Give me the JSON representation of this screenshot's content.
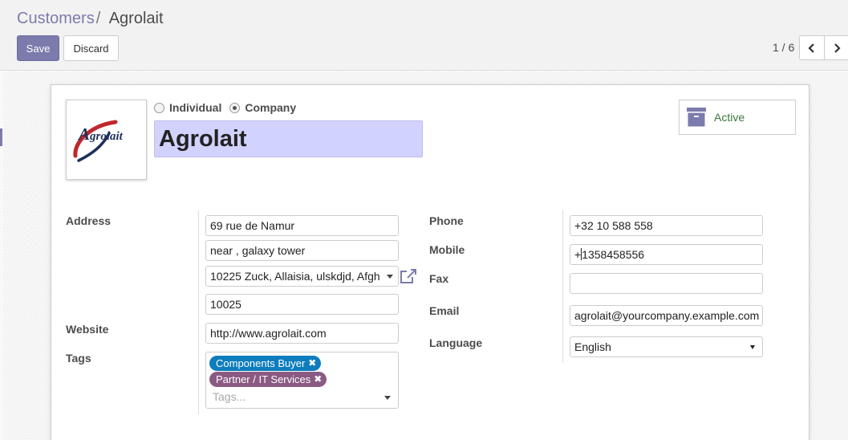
{
  "breadcrumb": {
    "parent": "Customers",
    "separator": "/",
    "current": "Agrolait"
  },
  "buttons": {
    "save": "Save",
    "discard": "Discard"
  },
  "pager": {
    "value": "1 / 6"
  },
  "partner": {
    "type_options": [
      "Individual",
      "Company"
    ],
    "selected_type": "Company",
    "name": "Agrolait",
    "logo_text": "Agrolait",
    "active_label": "Active"
  },
  "labels": {
    "address": "Address",
    "website": "Website",
    "tags": "Tags",
    "phone": "Phone",
    "mobile": "Mobile",
    "fax": "Fax",
    "email": "Email",
    "language": "Language"
  },
  "address": {
    "street": "69 rue de Namur",
    "street2": "near , galaxy tower",
    "city_zip": "10225 Zuck, Allaisia, ulskdjd, Afgh",
    "zip": "10025"
  },
  "website": "http://www.agrolait.com",
  "tags": [
    {
      "label": "Components Buyer",
      "color": "#0e7dbd"
    },
    {
      "label": "Partner / IT Services",
      "color": "#8a5a82"
    }
  ],
  "tags_placeholder": "Tags...",
  "phone": "+32 10 588 558",
  "mobile": {
    "before_cursor": "+",
    "after_cursor": "1358458556"
  },
  "fax": "",
  "email": "agrolait@yourcompany.example.com",
  "language": "English",
  "colors": {
    "accent": "#7c7bad",
    "name_bg": "#d2d2ff",
    "active_green": "#3c763d"
  }
}
